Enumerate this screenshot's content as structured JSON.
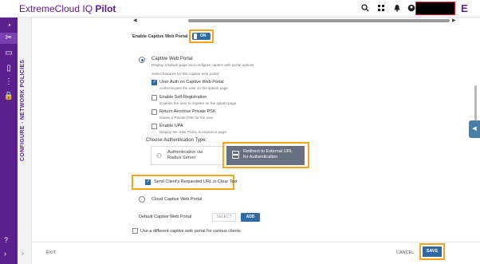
{
  "topbar": {
    "brand": "ExtremeCloud IQ",
    "brand_suffix": "Pilot",
    "icons": [
      "search-icon",
      "apps-icon",
      "bell-icon",
      "user-icon"
    ],
    "logo": "E"
  },
  "section_title": "CONFIGURE - NETWORK POLICIES",
  "captive": {
    "enable_label": "Enable Captive Web Portal",
    "toggle_label": "ON",
    "portal_title": "Captive Web Portal",
    "portal_desc": "Display a splash page and configure captive web portal options",
    "select_features": "Select features for this captive web portal:",
    "features": [
      {
        "label": "User Auth on Captive Web Portal",
        "desc": "Authenticates the user on the splash page",
        "checked": true
      },
      {
        "label": "Enable Self-Registration",
        "desc": "Enables the user to register on the splash page",
        "checked": false
      },
      {
        "label": "Return Aerohive Private PSK",
        "desc": "Issues a Private PSK for the user",
        "checked": false
      },
      {
        "label": "Enable UPA",
        "desc": "Display the User Policy Acceptance page",
        "checked": false
      }
    ],
    "auth_type_label": "Choose Authentication Type:",
    "auth_options": [
      {
        "line1": "Authentication via",
        "line2": "Radius Server",
        "icon": "user-network-icon",
        "selected": false
      },
      {
        "line1": "Redirect to External URL",
        "line2": "for Authentication",
        "icon": "server-icon",
        "selected": true
      }
    ],
    "clear_text_label": "Send Client's Requested URL in Clear Text",
    "cloud_portal": "Cloud Captive Web Portal",
    "default_portal_label": "Default Captive Web Portal",
    "select_label": "SELECT",
    "add_label": "ADD",
    "different_portal_label": "Use a different captive web portal for various clients"
  },
  "footer": {
    "exit": "EXIT",
    "cancel": "CANCEL",
    "save": "SAVE"
  },
  "colors": {
    "nav": "#5b1f8e",
    "primary": "#2f6aa3",
    "highlight": "#f3a51b"
  }
}
